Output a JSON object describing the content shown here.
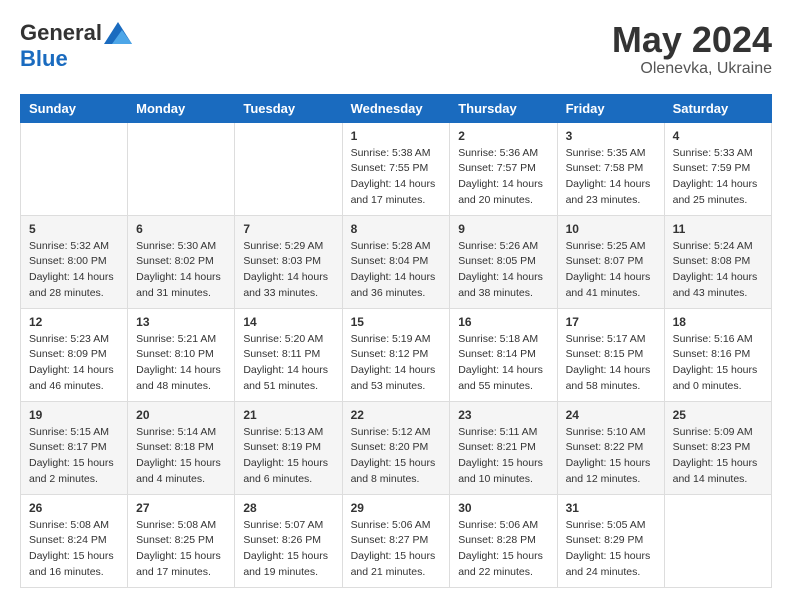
{
  "header": {
    "logo_general": "General",
    "logo_blue": "Blue",
    "month_year": "May 2024",
    "location": "Olenevka, Ukraine"
  },
  "weekdays": [
    "Sunday",
    "Monday",
    "Tuesday",
    "Wednesday",
    "Thursday",
    "Friday",
    "Saturday"
  ],
  "weeks": [
    [
      {
        "day": "",
        "empty": true
      },
      {
        "day": "",
        "empty": true
      },
      {
        "day": "",
        "empty": true
      },
      {
        "day": "1",
        "sunrise": "5:38 AM",
        "sunset": "7:55 PM",
        "daylight": "14 hours and 17 minutes."
      },
      {
        "day": "2",
        "sunrise": "5:36 AM",
        "sunset": "7:57 PM",
        "daylight": "14 hours and 20 minutes."
      },
      {
        "day": "3",
        "sunrise": "5:35 AM",
        "sunset": "7:58 PM",
        "daylight": "14 hours and 23 minutes."
      },
      {
        "day": "4",
        "sunrise": "5:33 AM",
        "sunset": "7:59 PM",
        "daylight": "14 hours and 25 minutes."
      }
    ],
    [
      {
        "day": "5",
        "sunrise": "5:32 AM",
        "sunset": "8:00 PM",
        "daylight": "14 hours and 28 minutes."
      },
      {
        "day": "6",
        "sunrise": "5:30 AM",
        "sunset": "8:02 PM",
        "daylight": "14 hours and 31 minutes."
      },
      {
        "day": "7",
        "sunrise": "5:29 AM",
        "sunset": "8:03 PM",
        "daylight": "14 hours and 33 minutes."
      },
      {
        "day": "8",
        "sunrise": "5:28 AM",
        "sunset": "8:04 PM",
        "daylight": "14 hours and 36 minutes."
      },
      {
        "day": "9",
        "sunrise": "5:26 AM",
        "sunset": "8:05 PM",
        "daylight": "14 hours and 38 minutes."
      },
      {
        "day": "10",
        "sunrise": "5:25 AM",
        "sunset": "8:07 PM",
        "daylight": "14 hours and 41 minutes."
      },
      {
        "day": "11",
        "sunrise": "5:24 AM",
        "sunset": "8:08 PM",
        "daylight": "14 hours and 43 minutes."
      }
    ],
    [
      {
        "day": "12",
        "sunrise": "5:23 AM",
        "sunset": "8:09 PM",
        "daylight": "14 hours and 46 minutes."
      },
      {
        "day": "13",
        "sunrise": "5:21 AM",
        "sunset": "8:10 PM",
        "daylight": "14 hours and 48 minutes."
      },
      {
        "day": "14",
        "sunrise": "5:20 AM",
        "sunset": "8:11 PM",
        "daylight": "14 hours and 51 minutes."
      },
      {
        "day": "15",
        "sunrise": "5:19 AM",
        "sunset": "8:12 PM",
        "daylight": "14 hours and 53 minutes."
      },
      {
        "day": "16",
        "sunrise": "5:18 AM",
        "sunset": "8:14 PM",
        "daylight": "14 hours and 55 minutes."
      },
      {
        "day": "17",
        "sunrise": "5:17 AM",
        "sunset": "8:15 PM",
        "daylight": "14 hours and 58 minutes."
      },
      {
        "day": "18",
        "sunrise": "5:16 AM",
        "sunset": "8:16 PM",
        "daylight": "15 hours and 0 minutes."
      }
    ],
    [
      {
        "day": "19",
        "sunrise": "5:15 AM",
        "sunset": "8:17 PM",
        "daylight": "15 hours and 2 minutes."
      },
      {
        "day": "20",
        "sunrise": "5:14 AM",
        "sunset": "8:18 PM",
        "daylight": "15 hours and 4 minutes."
      },
      {
        "day": "21",
        "sunrise": "5:13 AM",
        "sunset": "8:19 PM",
        "daylight": "15 hours and 6 minutes."
      },
      {
        "day": "22",
        "sunrise": "5:12 AM",
        "sunset": "8:20 PM",
        "daylight": "15 hours and 8 minutes."
      },
      {
        "day": "23",
        "sunrise": "5:11 AM",
        "sunset": "8:21 PM",
        "daylight": "15 hours and 10 minutes."
      },
      {
        "day": "24",
        "sunrise": "5:10 AM",
        "sunset": "8:22 PM",
        "daylight": "15 hours and 12 minutes."
      },
      {
        "day": "25",
        "sunrise": "5:09 AM",
        "sunset": "8:23 PM",
        "daylight": "15 hours and 14 minutes."
      }
    ],
    [
      {
        "day": "26",
        "sunrise": "5:08 AM",
        "sunset": "8:24 PM",
        "daylight": "15 hours and 16 minutes."
      },
      {
        "day": "27",
        "sunrise": "5:08 AM",
        "sunset": "8:25 PM",
        "daylight": "15 hours and 17 minutes."
      },
      {
        "day": "28",
        "sunrise": "5:07 AM",
        "sunset": "8:26 PM",
        "daylight": "15 hours and 19 minutes."
      },
      {
        "day": "29",
        "sunrise": "5:06 AM",
        "sunset": "8:27 PM",
        "daylight": "15 hours and 21 minutes."
      },
      {
        "day": "30",
        "sunrise": "5:06 AM",
        "sunset": "8:28 PM",
        "daylight": "15 hours and 22 minutes."
      },
      {
        "day": "31",
        "sunrise": "5:05 AM",
        "sunset": "8:29 PM",
        "daylight": "15 hours and 24 minutes."
      },
      {
        "day": "",
        "empty": true
      }
    ]
  ]
}
